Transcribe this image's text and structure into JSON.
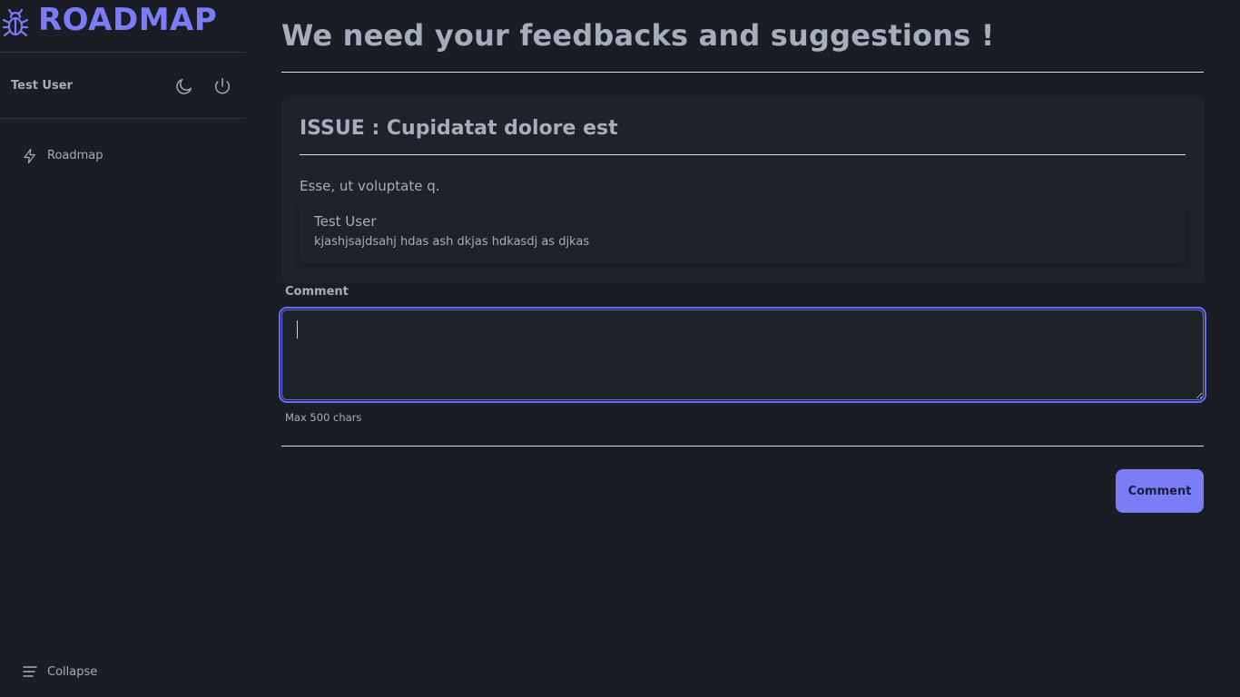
{
  "brand": {
    "name": "ROADMAP",
    "icon": "bug-icon",
    "color": "#7b7cf6"
  },
  "user": {
    "name": "Test User"
  },
  "header_icons": [
    "moon-icon",
    "power-icon"
  ],
  "sidebar": {
    "items": [
      {
        "label": "Roadmap",
        "icon": "bolt-icon"
      }
    ],
    "collapse_label": "Collapse"
  },
  "main": {
    "title": "We need your feedbacks and suggestions !",
    "issue": {
      "title": "ISSUE : Cupidatat dolore est",
      "description": "Esse, ut voluptate q.",
      "comments": [
        {
          "author": "Test User",
          "text": "kjashjsajdsahj hdas ash dkjas hdkasdj as djkas"
        }
      ]
    },
    "form": {
      "label": "Comment",
      "value": "",
      "hint": "Max 500 chars",
      "submit_label": "Comment"
    }
  },
  "colors": {
    "background": "#1a1d24",
    "accent": "#7b7cf6",
    "text": "#a6adbb",
    "divider": "#22384d"
  }
}
